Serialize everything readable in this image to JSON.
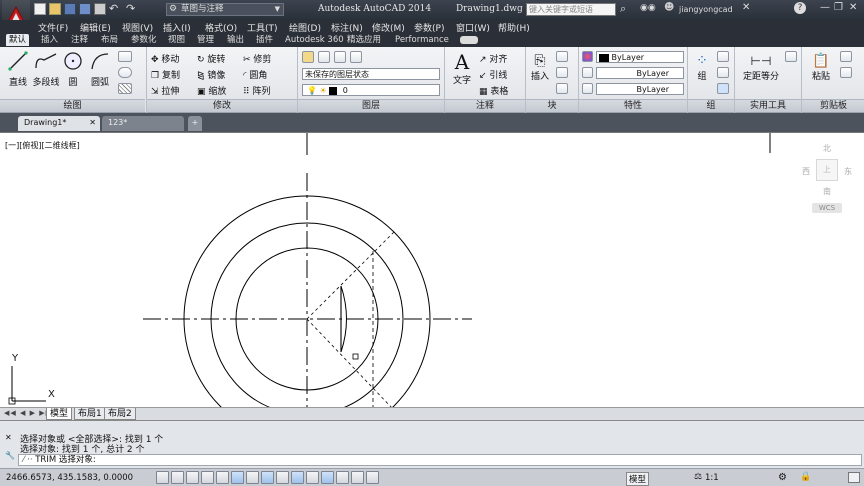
{
  "title_bar": {
    "workspace": "草图与注释",
    "app_title": "Autodesk AutoCAD 2014",
    "doc_title": "Drawing1.dwg",
    "search_placeholder": "键入关键字或短语",
    "user": "jiangyongcad"
  },
  "menu": [
    "文件(F)",
    "编辑(E)",
    "视图(V)",
    "插入(I)",
    "格式(O)",
    "工具(T)",
    "绘图(D)",
    "标注(N)",
    "修改(M)",
    "参数(P)",
    "窗口(W)",
    "帮助(H)"
  ],
  "ribbon_tabs": [
    "默认",
    "插入",
    "注释",
    "布局",
    "参数化",
    "视图",
    "管理",
    "输出",
    "插件",
    "Autodesk 360",
    "精选应用",
    "Performance"
  ],
  "ribbon": {
    "draw": {
      "line": "直线",
      "polyline": "多段线",
      "circle": "圆",
      "arc": "圆弧",
      "label": "绘图"
    },
    "modify": {
      "move": "移动",
      "rotate": "旋转",
      "trim": "修剪",
      "copy": "复制",
      "mirror": "镜像",
      "fillet": "圆角",
      "stretch": "拉伸",
      "scale": "缩放",
      "array": "阵列",
      "label": "修改"
    },
    "layers": {
      "state": "未保存的图层状态",
      "current": "0",
      "label": "图层"
    },
    "annotation": {
      "text": "文字",
      "align": "对齐",
      "leader": "引线",
      "table": "表格",
      "label": "注释"
    },
    "block": {
      "insert": "插入",
      "label": "块"
    },
    "properties": {
      "color": "ByLayer",
      "linetype": "ByLayer",
      "lineweight": "ByLayer",
      "label": "特性"
    },
    "groups": {
      "group": "组",
      "label": "组"
    },
    "utilities": {
      "measure": "定距等分",
      "label": "实用工具"
    },
    "clipboard": {
      "paste": "粘贴",
      "label": "剪贴板"
    }
  },
  "doc_tabs": [
    {
      "name": "Drawing1*",
      "active": true
    },
    {
      "name": "123*",
      "active": false
    }
  ],
  "viewport_label": "[一][俯视][二维线框]",
  "viewcube": {
    "north": "北",
    "south": "南",
    "east": "东",
    "west": "西",
    "top": "上",
    "wcs": "WCS"
  },
  "ucs": {
    "x": "X",
    "y": "Y"
  },
  "layout_tabs": [
    "模型",
    "布局1",
    "布局2"
  ],
  "command_history": [
    "选择对象或 <全部选择>: 找到 1 个",
    "选择对象: 找到 1 个, 总计 2 个"
  ],
  "command_line": "TRIM 选择对象:",
  "status": {
    "coords": "2466.6573, 435.1583, 0.0000",
    "model": "模型",
    "scale": "1:1"
  },
  "colors": {
    "titlebar": "#2f353e",
    "ribbon": "#e8ebef",
    "canvas": "#ffffff",
    "accent_red": "#c21a1a"
  }
}
